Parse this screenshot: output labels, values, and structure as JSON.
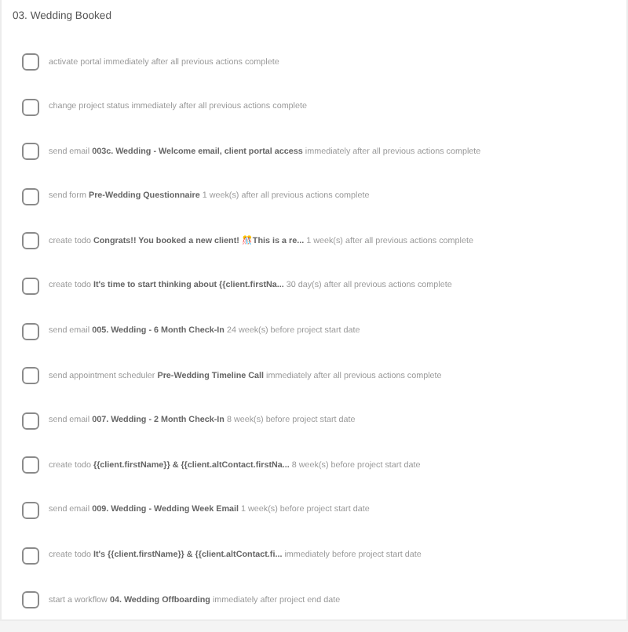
{
  "section": {
    "title": "03. Wedding Booked"
  },
  "actions": [
    {
      "checked": false,
      "text": "activate portal immediately after all previous actions complete"
    },
    {
      "checked": false,
      "text": "change project status immediately after all previous actions complete"
    },
    {
      "checked": false,
      "text": "send email **003c. Wedding - Welcome email, client portal access** immediately after all previous actions complete"
    },
    {
      "checked": false,
      "text": "send form **Pre-Wedding Questionnaire** 1 week(s) after all previous actions complete"
    },
    {
      "checked": false,
      "text": "create todo **Congrats!! You booked a new client! 🎊This is a re...** 1 week(s) after all previous actions complete"
    },
    {
      "checked": false,
      "text": "create todo **It's time to start thinking about {{client.firstNa...** 30 day(s) after all previous actions complete"
    },
    {
      "checked": false,
      "text": "send email **005. Wedding - 6 Month Check-In** 24 week(s) before project start date"
    },
    {
      "checked": false,
      "text": "send appointment scheduler **Pre-Wedding Timeline Call** immediately after all previous actions complete"
    },
    {
      "checked": false,
      "text": "send email **007. Wedding - 2 Month Check-In** 8 week(s) before project start date"
    },
    {
      "checked": false,
      "text": "create todo **{{client.firstName}} & {{client.altContact.firstNa...** 8 week(s) before project start date"
    },
    {
      "checked": false,
      "text": "send email **009. Wedding - Wedding Week Email** 1 week(s) before project start date"
    },
    {
      "checked": false,
      "text": "create todo **It's {{client.firstName}} & {{client.altContact.fi...** immediately before project start date"
    },
    {
      "checked": false,
      "text": "start a workflow **04. Wedding Offboarding** immediately after project end date"
    }
  ]
}
